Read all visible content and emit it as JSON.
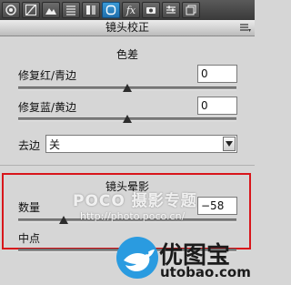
{
  "toolbar": {
    "tools": [
      {
        "icon": "aperture-icon"
      },
      {
        "icon": "tone-curve-icon"
      },
      {
        "icon": "mountains-icon"
      },
      {
        "icon": "detail-lines-icon"
      },
      {
        "icon": "hsl-icon"
      },
      {
        "icon": "lens-correction-icon",
        "active": true
      },
      {
        "icon": "fx-icon",
        "label": "fx"
      },
      {
        "icon": "camera-icon"
      },
      {
        "icon": "presets-icon"
      },
      {
        "icon": "snapshots-icon"
      }
    ],
    "active_color": "#2a86c6"
  },
  "panel": {
    "title": "镜头校正"
  },
  "chromatic": {
    "title": "色差",
    "red_cyan": {
      "label": "修复红/青边",
      "value": "0",
      "level_fraction": 0.5
    },
    "blue_yellow": {
      "label": "修复蓝/黄边",
      "value": "0",
      "level_fraction": 0.5
    }
  },
  "defringe": {
    "label": "去边",
    "selected": "关"
  },
  "vignette": {
    "title": "镜头晕影",
    "amount": {
      "label": "数量",
      "value": "−58",
      "level_fraction": 0.21
    },
    "midpoint": {
      "label": "中点",
      "value": "",
      "level_fraction": 0.56
    }
  },
  "watermark": {
    "poco": "POCO 摄影专题",
    "url": "http://photo.poco.cn/",
    "brand": "优图宝",
    "site": "utobao.com"
  },
  "highlight_color": "#d8161b"
}
